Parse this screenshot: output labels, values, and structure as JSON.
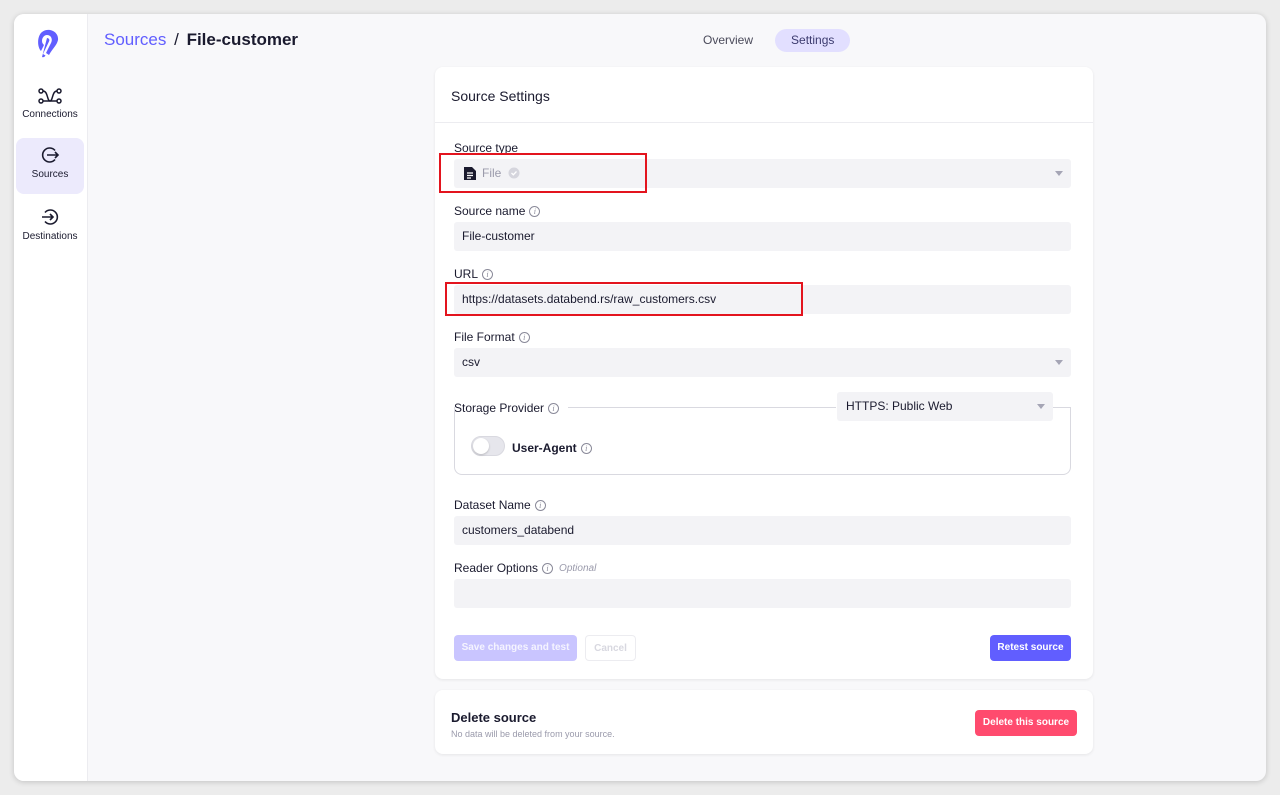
{
  "sidebar": {
    "items": [
      {
        "label": "Connections",
        "icon": "connections-icon"
      },
      {
        "label": "Sources",
        "icon": "sources-icon"
      },
      {
        "label": "Destinations",
        "icon": "destinations-icon"
      }
    ],
    "active": "Sources"
  },
  "breadcrumb": {
    "parent": "Sources",
    "separator": "/",
    "current": "File-customer"
  },
  "tabs": [
    {
      "label": "Overview",
      "active": false
    },
    {
      "label": "Settings",
      "active": true
    }
  ],
  "settings": {
    "title": "Source Settings",
    "source_type": {
      "label": "Source type",
      "value": "File"
    },
    "source_name": {
      "label": "Source name",
      "value": "File-customer"
    },
    "url": {
      "label": "URL",
      "value": "https://datasets.databend.rs/raw_customers.csv"
    },
    "file_format": {
      "label": "File Format",
      "value": "csv"
    },
    "storage_provider": {
      "label": "Storage Provider",
      "value": "HTTPS: Public Web"
    },
    "user_agent": {
      "label": "User-Agent",
      "enabled": false
    },
    "dataset_name": {
      "label": "Dataset Name",
      "value": "customers_databend"
    },
    "reader_options": {
      "label": "Reader Options",
      "optional": "Optional",
      "value": ""
    },
    "buttons": {
      "save": "Save changes and test",
      "cancel": "Cancel",
      "retest": "Retest source"
    }
  },
  "delete_section": {
    "title": "Delete source",
    "subtitle": "No data will be deleted from your source.",
    "button": "Delete this source"
  },
  "colors": {
    "accent": "#615eff",
    "danger": "#ff4b6e",
    "highlight": "#e3141e"
  }
}
